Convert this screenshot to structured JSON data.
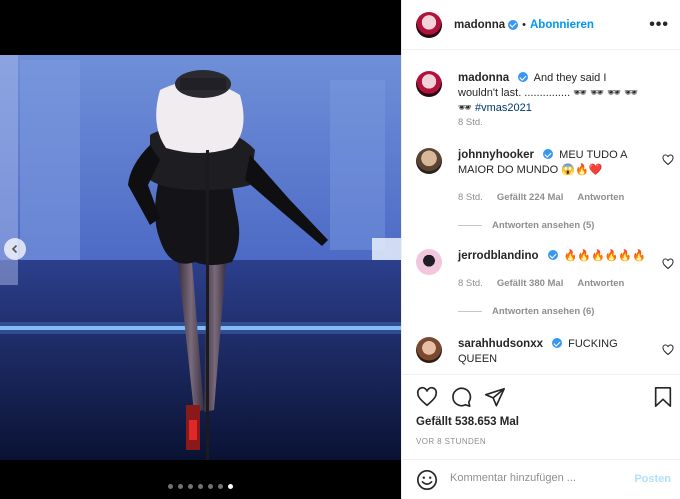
{
  "post": {
    "username": "madonna",
    "follow_label": "Abonnieren",
    "caption": "And they said I wouldn't last. ............... 🕶 🕶 🕶 🕶 🕶",
    "hashtag": "#vmas2021",
    "caption_time": "8 Std.",
    "likes": "Gefällt 538.653 Mal",
    "posted_ago": "VOR 8 STUNDEN"
  },
  "comments": [
    {
      "username": "johnnyhooker",
      "text": "MEU TUDO A MAIOR DO MUNDO 😱🔥❤️",
      "time": "8 Std.",
      "likes": "Gefällt 224 Mal",
      "reply_label": "Antworten",
      "view_replies": "Antworten ansehen (5)"
    },
    {
      "username": "jerrodblandino",
      "text": "🔥🔥🔥🔥🔥🔥",
      "time": "8 Std.",
      "likes": "Gefällt 380 Mal",
      "reply_label": "Antworten",
      "view_replies": "Antworten ansehen (6)"
    },
    {
      "username": "sarahhudsonxx",
      "text": "FUCKING QUEEN"
    }
  ],
  "compose": {
    "placeholder": "Kommentar hinzufügen ...",
    "post_label": "Posten"
  },
  "carousel": {
    "slide_count": 7,
    "active_index": 6
  },
  "icons": {
    "more": "more-options-icon",
    "like": "heart-icon",
    "comment": "comment-icon",
    "share": "paper-plane-icon",
    "save": "bookmark-icon",
    "emoji": "emoji-icon",
    "prev": "chevron-left-icon"
  },
  "colors": {
    "accent": "#0095f6",
    "verified": "#3897f0",
    "muted": "#8e8e8e",
    "post_disabled": "#b2dffc"
  }
}
